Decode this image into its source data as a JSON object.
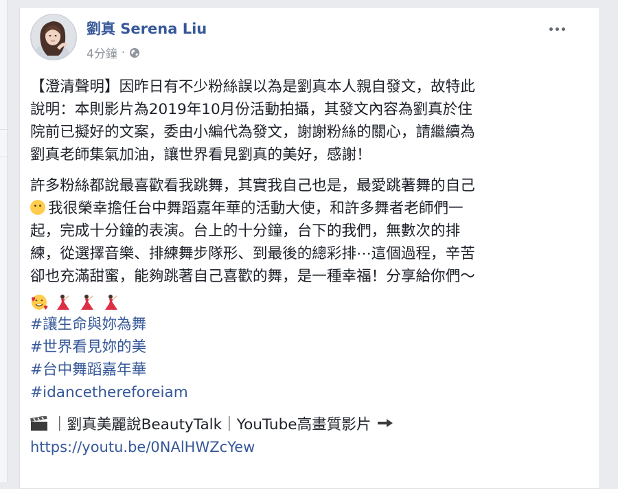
{
  "post": {
    "author_name": "劉真 Serena Liu",
    "timestamp": "4分鐘",
    "separator": "·",
    "privacy_icon": "globe-icon",
    "menu_icon": "more-options-icon",
    "paragraph1_lines": [
      "【澄清聲明】因昨日有不少粉絲誤以為是劉真本人親自發文，故特此",
      "說明：本則影片為2019年10月份活動拍攝，其發文內容為劉真於住",
      "院前已擬好的文案，委由小編代為發文，謝謝粉絲的關心，請繼續為",
      "劉真老師集氣加油，讓世界看見劉真的美好，感謝！"
    ],
    "paragraph2_line1": "許多粉絲都說最喜歡看我跳舞，其實我自己也是，最愛跳著舞的自己",
    "paragraph2_line2": "我很榮幸擔任台中舞蹈嘉年華的活動大使，和許多舞者老師們一",
    "paragraph2_lines_rest": [
      "起，完成十分鐘的表演。台上的十分鐘，台下的我們，無數次的排",
      "練，從選擇音樂、排練舞步隊形、到最後的總彩排⋯這個過程，辛苦",
      "卻也充滿甜蜜，能夠跳著自己喜歡的舞，是一種幸福！分享給你們～"
    ],
    "emojis": [
      "smiling-face-with-hearts-icon",
      "dancer-icon",
      "dancer-icon",
      "dancer-icon"
    ],
    "hashtags": [
      "#讓生命與妳為舞",
      "#世界看見妳的美",
      "#台中舞蹈嘉年華",
      "#idancethereforeiam"
    ],
    "video_line": "｜劉真美麗說BeautyTalk｜YouTube高畫質影片",
    "link_url": "https://youtu.be/0NAlHWZcYew"
  },
  "colors": {
    "link_blue": "#365899",
    "text": "#1d2129",
    "meta_gray": "#90949c",
    "page_bg": "#e9ebee"
  }
}
